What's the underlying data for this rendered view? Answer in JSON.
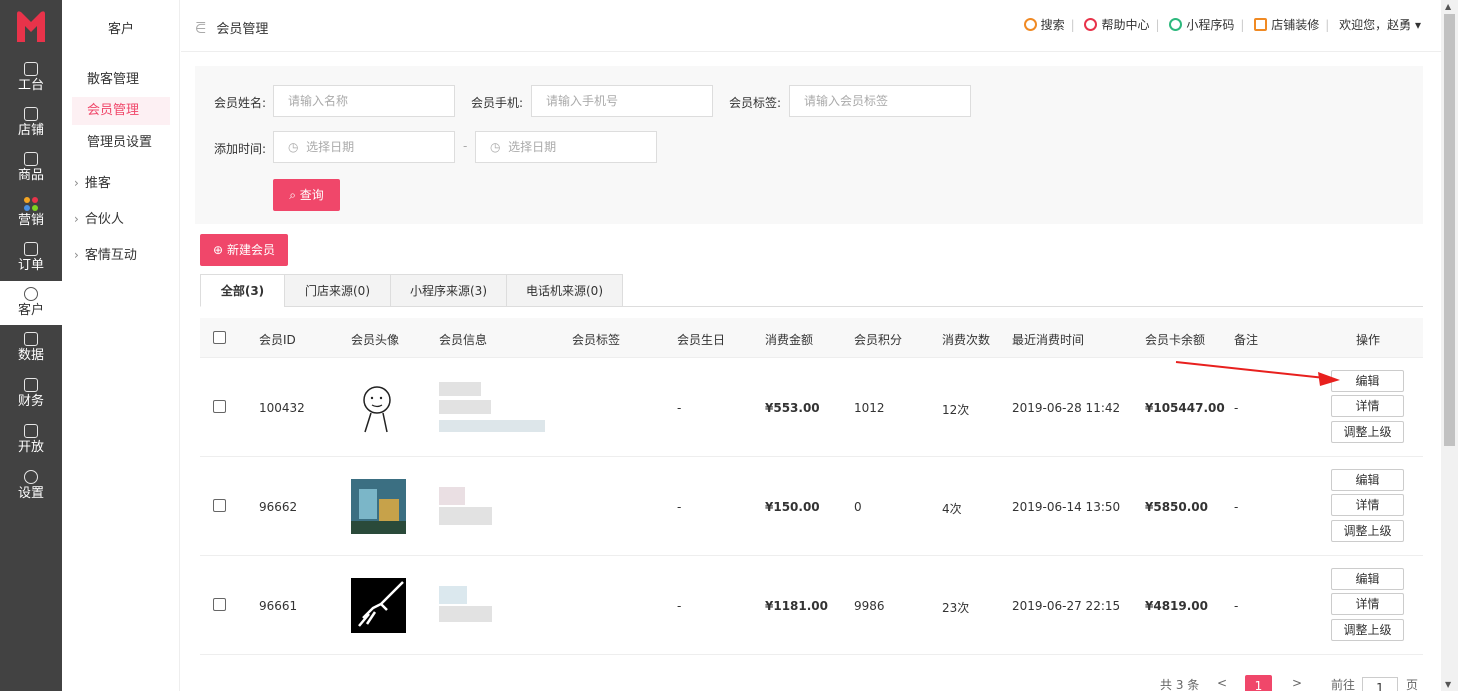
{
  "rail": {
    "items": [
      {
        "label": "工台"
      },
      {
        "label": "店铺"
      },
      {
        "label": "商品"
      },
      {
        "label": "营销"
      },
      {
        "label": "订单"
      },
      {
        "label": "客户"
      },
      {
        "label": "数据"
      },
      {
        "label": "财务"
      },
      {
        "label": "开放"
      },
      {
        "label": "设置"
      }
    ]
  },
  "submenu": {
    "title": "客户",
    "items": [
      "散客管理",
      "会员管理",
      "管理员设置"
    ],
    "groups": [
      "推客",
      "合伙人",
      "客情互动"
    ]
  },
  "topbar": {
    "breadcrumb": "会员管理",
    "links": [
      "搜索",
      "帮助中心",
      "小程序码",
      "店铺装修"
    ],
    "welcome": "欢迎您，赵勇"
  },
  "filter": {
    "name_label": "会员姓名:",
    "name_placeholder": "请输入名称",
    "phone_label": "会员手机:",
    "phone_placeholder": "请输入手机号",
    "tag_label": "会员标签:",
    "tag_placeholder": "请输入会员标签",
    "time_label": "添加时间:",
    "date_placeholder": "选择日期",
    "date_sep": "-",
    "query_label": "查询"
  },
  "new_member_label": "新建会员",
  "tabs": [
    "全部(3)",
    "门店来源(0)",
    "小程序来源(3)",
    "电话机来源(0)"
  ],
  "table": {
    "headers": [
      "会员ID",
      "会员头像",
      "会员信息",
      "会员标签",
      "会员生日",
      "消费金额",
      "会员积分",
      "消费次数",
      "最近消费时间",
      "会员卡余额",
      "备注",
      "操作"
    ],
    "rows": [
      {
        "id": "100432",
        "birthday": "-",
        "amount": "¥553.00",
        "points": "1012",
        "count": "12次",
        "last": "2019-06-28 11:42",
        "balance": "¥105447.00",
        "note": "-"
      },
      {
        "id": "96662",
        "birthday": "-",
        "amount": "¥150.00",
        "points": "0",
        "count": "4次",
        "last": "2019-06-14 13:50",
        "balance": "¥5850.00",
        "note": "-"
      },
      {
        "id": "96661",
        "birthday": "-",
        "amount": "¥1181.00",
        "points": "9986",
        "count": "23次",
        "last": "2019-06-27 22:15",
        "balance": "¥4819.00",
        "note": "-"
      }
    ],
    "actions": [
      "编辑",
      "详情",
      "调整上级"
    ]
  },
  "pager": {
    "total": "共 3 条",
    "prev": "<",
    "current": "1",
    "next": ">",
    "goto": "前往",
    "page_value": "1",
    "page_unit": "页"
  },
  "colors": {
    "accent": "#f0476a",
    "rail": "#424242"
  }
}
